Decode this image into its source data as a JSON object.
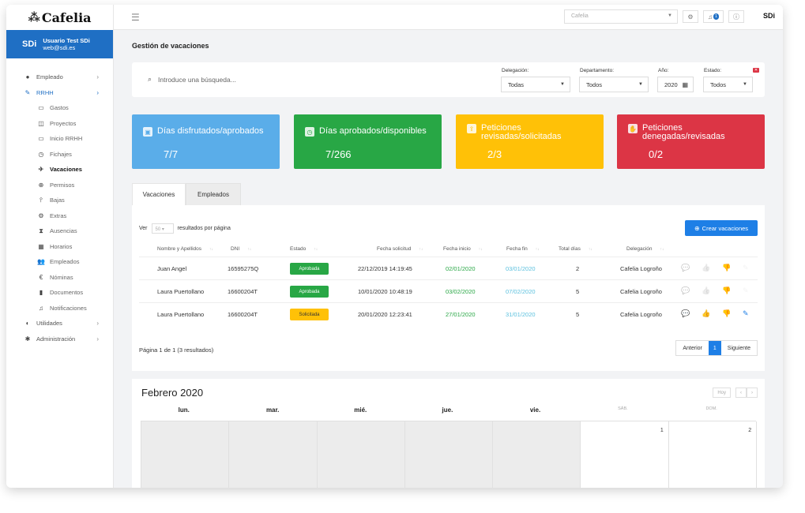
{
  "app": {
    "logo": "Cafelia"
  },
  "user": {
    "initials": "SDi",
    "name": "Usuario Test SDi",
    "email": "web@sdi.es"
  },
  "nav": [
    {
      "label": "Empleado",
      "icon": "user-circle-icon",
      "glyph": "●",
      "chevron": "›",
      "level": "top"
    },
    {
      "label": "RRHH",
      "icon": "pencil-icon",
      "glyph": "✎",
      "chevron": "›",
      "level": "top-active"
    },
    {
      "label": "Gastos",
      "icon": "card-icon",
      "glyph": "▭",
      "level": "sub"
    },
    {
      "label": "Proyectos",
      "icon": "folder-icon",
      "glyph": "◫",
      "level": "sub"
    },
    {
      "label": "Inicio RRHH",
      "icon": "monitor-icon",
      "glyph": "▭",
      "level": "sub"
    },
    {
      "label": "Fichajes",
      "icon": "clock-icon",
      "glyph": "◷",
      "level": "sub"
    },
    {
      "label": "Vacaciones",
      "icon": "plane-icon",
      "glyph": "✈",
      "level": "sub-active"
    },
    {
      "label": "Permisos",
      "icon": "globe-icon",
      "glyph": "⊕",
      "level": "sub"
    },
    {
      "label": "Bajas",
      "icon": "thermometer-icon",
      "glyph": "⫯",
      "level": "sub"
    },
    {
      "label": "Extras",
      "icon": "gears-icon",
      "glyph": "⚙",
      "level": "sub"
    },
    {
      "label": "Ausencias",
      "icon": "hourglass-icon",
      "glyph": "⧗",
      "level": "sub"
    },
    {
      "label": "Horarios",
      "icon": "calendar-grid-icon",
      "glyph": "▦",
      "level": "sub"
    },
    {
      "label": "Empleados",
      "icon": "users-icon",
      "glyph": "👥",
      "level": "sub"
    },
    {
      "label": "Nóminas",
      "icon": "euro-icon",
      "glyph": "€",
      "level": "sub"
    },
    {
      "label": "Documentos",
      "icon": "file-icon",
      "glyph": "▮",
      "level": "sub"
    },
    {
      "label": "Notificaciones",
      "icon": "bell-icon",
      "glyph": "♫",
      "level": "sub"
    },
    {
      "label": "Utilidades",
      "icon": "shield-icon",
      "glyph": "◐",
      "chevron": "›",
      "level": "top"
    },
    {
      "label": "Administración",
      "icon": "puzzle-icon",
      "glyph": "✱",
      "chevron": "›",
      "level": "top"
    }
  ],
  "topbar": {
    "company": "Cafelia",
    "notifications": "1",
    "brand": "SDi"
  },
  "page": {
    "title": "Gestión de vacaciones"
  },
  "filters": {
    "search_placeholder": "Introduce una búsqueda...",
    "delegacion": {
      "label": "Delegación:",
      "value": "Todas"
    },
    "departamento": {
      "label": "Departamento:",
      "value": "Todos"
    },
    "anio": {
      "label": "Año:",
      "value": "2020"
    },
    "estado": {
      "label": "Estado:",
      "value": "Todos"
    }
  },
  "stats": [
    {
      "title": "Días disfrutados/aprobados",
      "value": "7/7",
      "color": "#5aade9",
      "icon": "briefcase-icon",
      "glyph": "▣"
    },
    {
      "title": "Días aprobados/disponibles",
      "value": "7/266",
      "color": "#28a745",
      "icon": "clock-icon",
      "glyph": "◷"
    },
    {
      "title": "Peticiones revisadas/solicitadas",
      "value": "2/3",
      "color": "#ffc107",
      "icon": "upload-icon",
      "glyph": "⇪"
    },
    {
      "title": "Peticiones denegadas/revisadas",
      "value": "0/2",
      "color": "#dc3545",
      "icon": "thumbs-down-icon",
      "glyph": "✋"
    }
  ],
  "tabs": [
    {
      "label": "Vacaciones"
    },
    {
      "label": "Empleados"
    }
  ],
  "table": {
    "show_prefix": "Ver",
    "page_size": "50",
    "show_suffix": "resultados por página",
    "create_label": "Crear vacaciones",
    "columns": [
      "Nombre y Apellidos",
      "DNI",
      "Estado",
      "Fecha solicitud",
      "Fecha inicio",
      "Fecha fin",
      "Total días",
      "Delegación"
    ],
    "rows": [
      {
        "name": "Juan Angel",
        "dni": "16595275Q",
        "status": "Aprobada",
        "requested": "22/12/2019 14:19:45",
        "start": "02/01/2020",
        "end": "03/01/2020",
        "days": "2",
        "delegation": "Cafelia Logroño",
        "actions_active": false
      },
      {
        "name": "Laura Puertollano",
        "dni": "16600204T",
        "status": "Aprobada",
        "requested": "10/01/2020 10:48:19",
        "start": "03/02/2020",
        "end": "07/02/2020",
        "days": "5",
        "delegation": "Cafelia Logroño",
        "actions_active": false
      },
      {
        "name": "Laura Puertollano",
        "dni": "16600204T",
        "status": "Solicitada",
        "requested": "20/01/2020 12:23:41",
        "start": "27/01/2020",
        "end": "31/01/2020",
        "days": "5",
        "delegation": "Cafelia Logroño",
        "actions_active": true
      }
    ],
    "page_info": "Página 1 de 1 (3 resultados)",
    "prev_label": "Anterior",
    "current_page": "1",
    "next_label": "Siguiente"
  },
  "calendar": {
    "title": "Febrero 2020",
    "today_label": "Hoy",
    "prev": "‹",
    "next": "›",
    "days": [
      "lun.",
      "mar.",
      "mié.",
      "jue.",
      "vie.",
      "SÁB.",
      "DOM."
    ],
    "first_row": [
      "",
      "",
      "",
      "",
      "",
      "1",
      "2"
    ]
  }
}
